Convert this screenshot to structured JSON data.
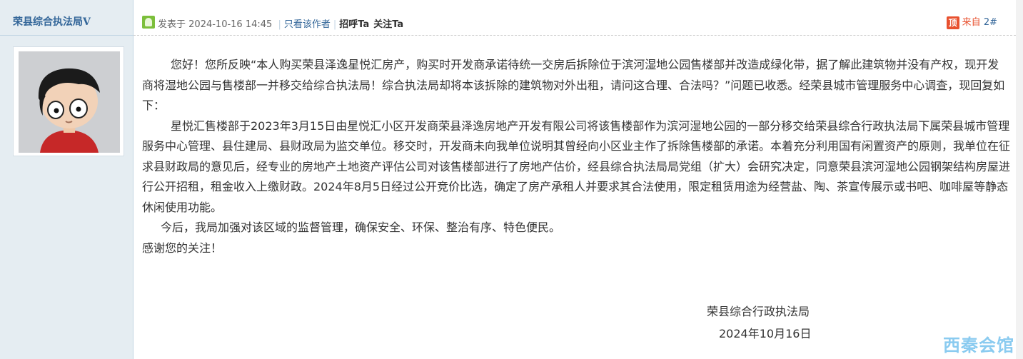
{
  "author": {
    "name": "荣县综合执法局",
    "badge": "V"
  },
  "post_meta": {
    "posted_prefix": "发表于",
    "posted_time": "2024-10-16 14:45",
    "only_author": "只看该作者",
    "greet": "招呼Ta",
    "follow": "关注Ta"
  },
  "floor": {
    "source_badge": "顶",
    "source": "来自",
    "number": "2#"
  },
  "content": {
    "paragraphs": [
      "您好！您所反映“本人购买荣县泽逸星悦汇房产，购买时开发商承诺待统一交房后拆除位于滨河湿地公园售楼部并改造成绿化带，据了解此建筑物并没有产权，现开发商将湿地公园与售楼部一并移交给综合执法局！综合执法局却将本该拆除的建筑物对外出租，请问这合理、合法吗？”问题已收悉。经荣县城市管理服务中心调查，现回复如下：",
      "星悦汇售楼部于2023年3月15日由星悦汇小区开发商荣县泽逸房地产开发有限公司将该售楼部作为滨河湿地公园的一部分移交给荣县综合行政执法局下属荣县城市管理服务中心管理、县住建局、县财政局为监交单位。移交时，开发商未向我单位说明其曾经向小区业主作了拆除售楼部的承诺。本着充分利用国有闲置资产的原则，我单位在征求县财政局的意见后，经专业的房地产土地资产评估公司对该售楼部进行了房地产估价，经县综合执法局局党组（扩大）会研究决定，同意荣县滨河湿地公园钢架结构房屋进行公开招租，租金收入上缴财政。2024年8月5日经过公开竞价比选，确定了房产承租人并要求其合法使用，限定租赁用途为经营盐、陶、茶宣传展示或书吧、咖啡屋等静态休闲使用功能。",
      "今后，我局加强对该区域的监督管理，确保安全、环保、整治有序、特色便民。",
      "感谢您的关注！"
    ],
    "signature_org": "荣县综合行政执法局",
    "signature_date": "2024年10月16日"
  },
  "watermark": "西秦会馆",
  "colors": {
    "sidebar_bg": "#e5edf2",
    "link": "#336699",
    "badge": "#e8502e",
    "online": "#7cbf3b"
  },
  "icons": {
    "online": "online-status-icon",
    "source": "source-badge-icon"
  }
}
